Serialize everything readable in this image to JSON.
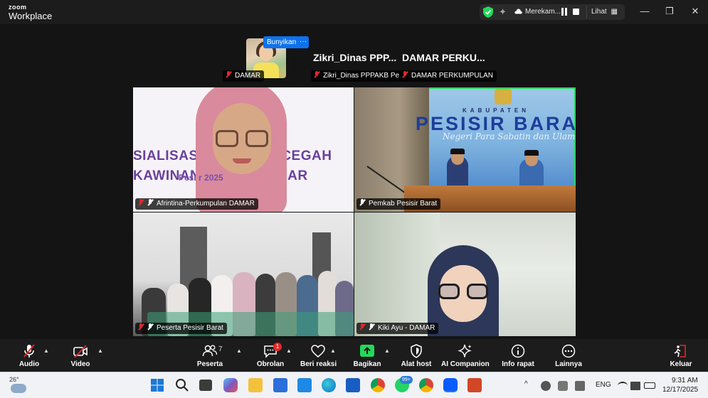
{
  "app": {
    "logo_top": "zoom",
    "logo_bottom": "Workplace"
  },
  "titlebar": {
    "recording_label": "Merekam...",
    "view_label": "Lihat",
    "window_min": "—",
    "window_max": "❐",
    "window_close": "✕"
  },
  "top_strip": {
    "self_name": "DAMAR",
    "unmute_label": "Bunyikan",
    "more_label": "···",
    "participant_1_big": "Zikri_Dinas PPP...",
    "participant_2_big": "DAMAR PERKU...",
    "participant_1_tag": "Zikri_Dinas PPPAKB Pe...",
    "participant_2_tag": "DAMAR PERKUMPULAN"
  },
  "tiles": [
    {
      "name": "Afrintina-Perkumpulan DAMAR",
      "banner_line1": "SIALISASI ST      AH PENCEGAH",
      "banner_line2": "KAWINAN A         PESISIR BAR",
      "banner_line3": "Pesi                     r 2025"
    },
    {
      "name": "Pemkab Pesisir Barat",
      "kab": "KABUPATEN",
      "title": "PESISIR BARA",
      "tagline": "Negeri Para Sabatin dan Ulama",
      "active": true
    },
    {
      "name": "Peserta Pesisir Barat"
    },
    {
      "name": "Kiki Ayu - DAMAR"
    }
  ],
  "toolbar": {
    "audio": "Audio",
    "video": "Video",
    "participants": "Peserta",
    "participants_count": "7",
    "chat": "Obrolan",
    "chat_badge": "1",
    "reactions": "Beri reaksi",
    "share": "Bagikan",
    "host_tools": "Alat host",
    "ai_companion": "AI Companion",
    "meeting_info": "Info rapat",
    "more": "Lainnya",
    "leave": "Keluar",
    "colors": {
      "share_green": "#23d959",
      "leave_red": "#e02828",
      "active_border": "#23d959"
    }
  },
  "taskbar": {
    "weather_temp": "26°",
    "whatsapp_badge": "99+",
    "language": "ENG",
    "time": "9:31 AM",
    "date": "12/17/2025",
    "tray_caret": "^"
  }
}
